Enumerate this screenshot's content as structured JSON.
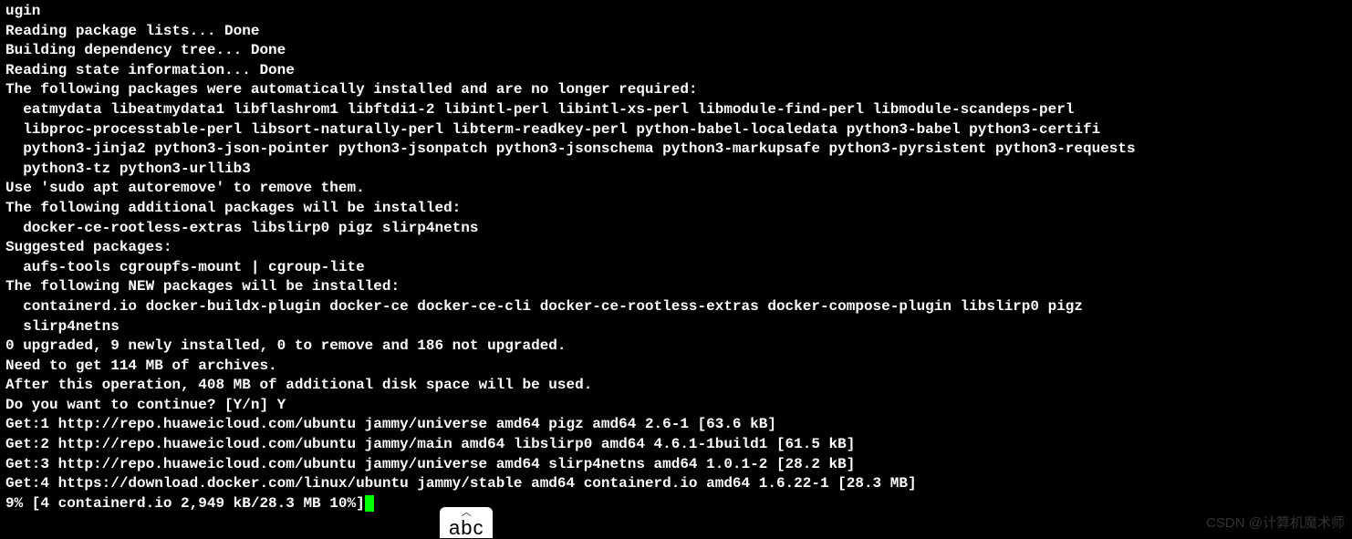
{
  "lines": {
    "l0": "ugin",
    "l1": "Reading package lists... Done",
    "l2": "Building dependency tree... Done",
    "l3": "Reading state information... Done",
    "l4": "The following packages were automatically installed and are no longer required:",
    "l5": "  eatmydata libeatmydata1 libflashrom1 libftdi1-2 libintl-perl libintl-xs-perl libmodule-find-perl libmodule-scandeps-perl",
    "l6": "  libproc-processtable-perl libsort-naturally-perl libterm-readkey-perl python-babel-localedata python3-babel python3-certifi",
    "l7": "  python3-jinja2 python3-json-pointer python3-jsonpatch python3-jsonschema python3-markupsafe python3-pyrsistent python3-requests",
    "l8": "  python3-tz python3-urllib3",
    "l9": "Use 'sudo apt autoremove' to remove them.",
    "l10": "The following additional packages will be installed:",
    "l11": "  docker-ce-rootless-extras libslirp0 pigz slirp4netns",
    "l12": "Suggested packages:",
    "l13": "  aufs-tools cgroupfs-mount | cgroup-lite",
    "l14": "The following NEW packages will be installed:",
    "l15": "  containerd.io docker-buildx-plugin docker-ce docker-ce-cli docker-ce-rootless-extras docker-compose-plugin libslirp0 pigz",
    "l16": "  slirp4netns",
    "l17": "0 upgraded, 9 newly installed, 0 to remove and 186 not upgraded.",
    "l18": "Need to get 114 MB of archives.",
    "l19": "After this operation, 408 MB of additional disk space will be used.",
    "l20": "Do you want to continue? [Y/n] Y",
    "l21": "Get:1 http://repo.huaweicloud.com/ubuntu jammy/universe amd64 pigz amd64 2.6-1 [63.6 kB]",
    "l22": "Get:2 http://repo.huaweicloud.com/ubuntu jammy/main amd64 libslirp0 amd64 4.6.1-1build1 [61.5 kB]",
    "l23": "Get:3 http://repo.huaweicloud.com/ubuntu jammy/universe amd64 slirp4netns amd64 1.0.1-2 [28.2 kB]",
    "l24": "Get:4 https://download.docker.com/linux/ubuntu jammy/stable amd64 containerd.io amd64 1.6.22-1 [28.3 MB]",
    "l25": "9% [4 containerd.io 2,949 kB/28.3 MB 10%]"
  },
  "ime": {
    "chevron": "︿",
    "text": "abc"
  },
  "watermark": "CSDN @计算机魔术师"
}
